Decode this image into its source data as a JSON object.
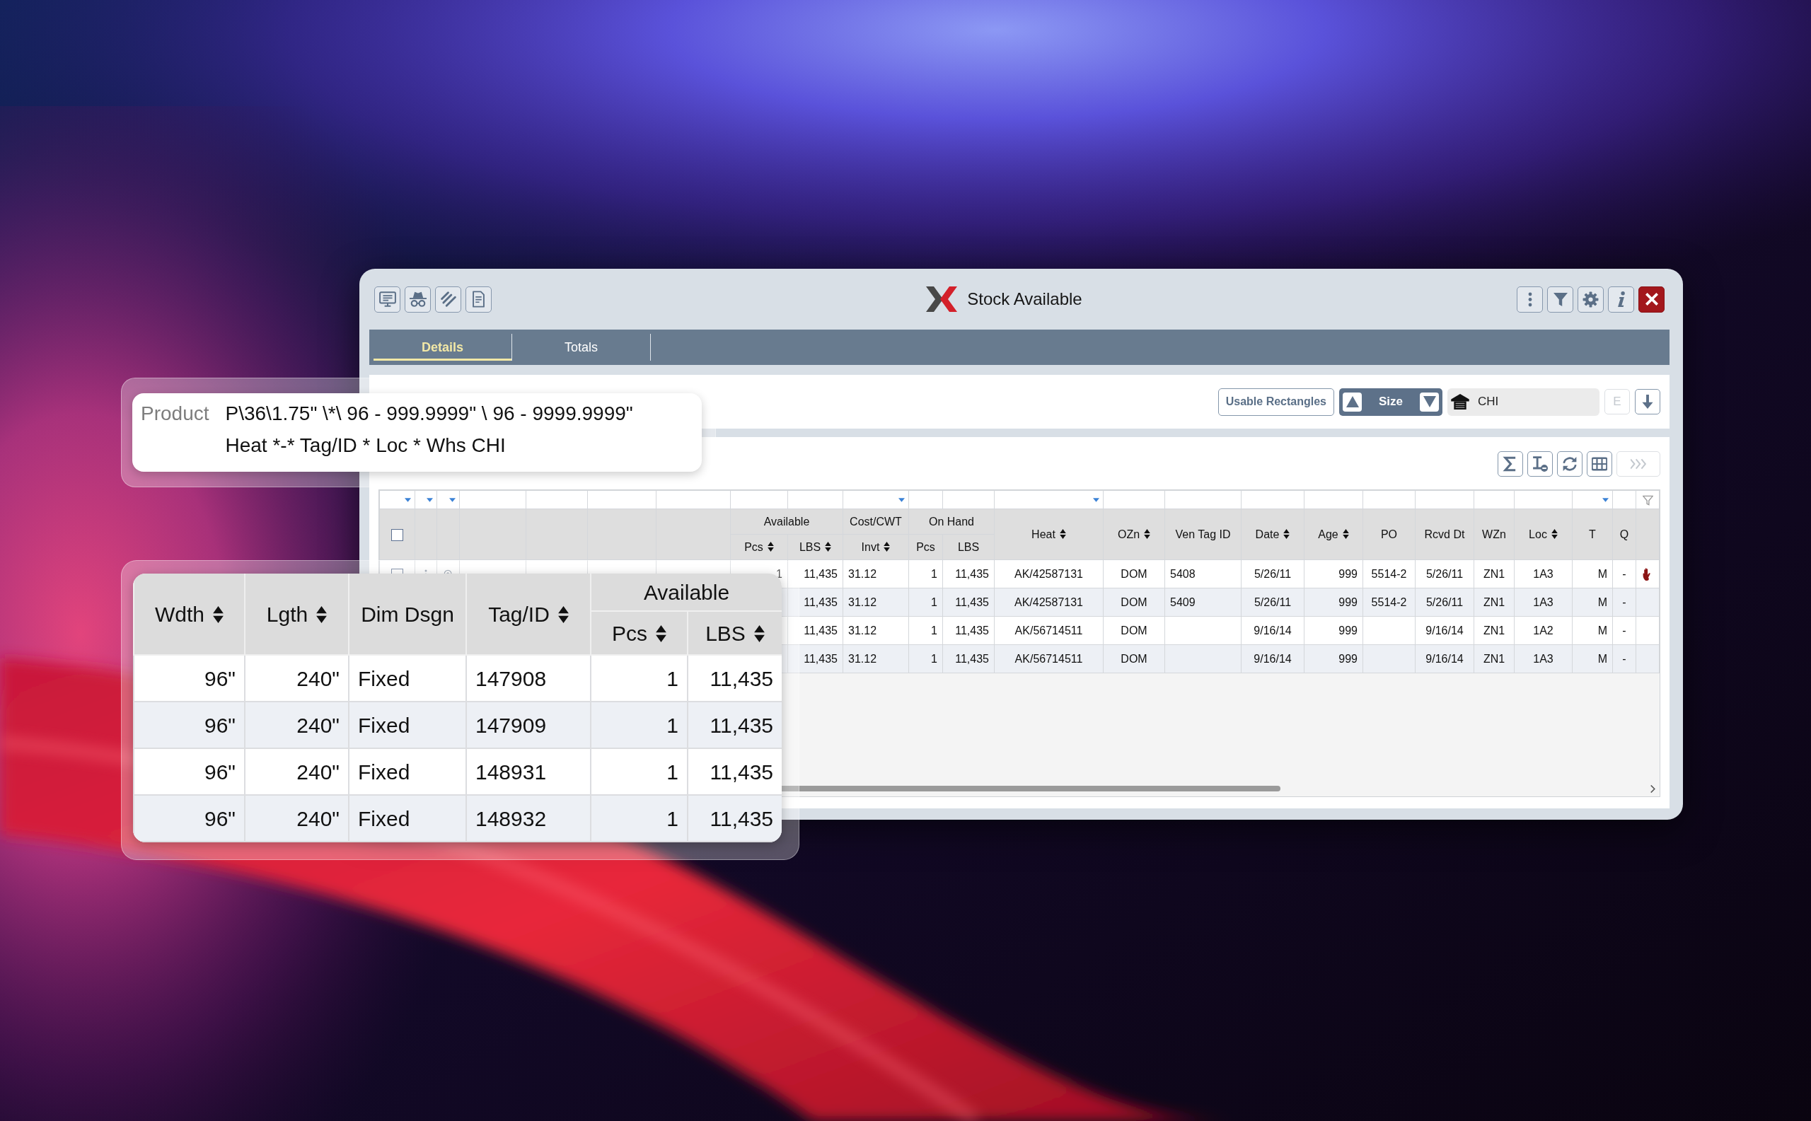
{
  "window": {
    "title": "Stock Available",
    "left_tools": [
      {
        "kind": "screen"
      },
      {
        "kind": "spy"
      },
      {
        "kind": "beams"
      },
      {
        "kind": "invoice"
      }
    ],
    "right_tools": [
      {
        "kind": "more"
      },
      {
        "kind": "filter"
      },
      {
        "kind": "settings"
      },
      {
        "kind": "info"
      },
      {
        "kind": "close"
      }
    ]
  },
  "tabs": [
    {
      "label": "Details",
      "selected": true
    },
    {
      "label": "Totals",
      "selected": false
    }
  ],
  "search_bar": {
    "button": "Usable Rectangles",
    "sort": {
      "label": "Size"
    },
    "warehouse": {
      "value": "CHI"
    },
    "actions": [
      {
        "kind": "letter",
        "label": "E",
        "disabled": true
      },
      {
        "kind": "download",
        "disabled": false
      }
    ]
  },
  "grid_toolbar": [
    {
      "kind": "sum",
      "disabled": false
    },
    {
      "kind": "beam",
      "disabled": false
    },
    {
      "kind": "refresh",
      "disabled": false
    },
    {
      "kind": "columns",
      "disabled": false
    },
    {
      "kind": "expand",
      "disabled": true
    }
  ],
  "grid": {
    "select_all": {
      "checked": false
    },
    "columns": [
      {
        "kind": "select",
        "filter_menu": true
      },
      {
        "kind": "menu",
        "filter_menu": true
      },
      {
        "kind": "zoom",
        "filter_menu": true
      },
      {
        "kind": "blank",
        "filter_menu": false
      },
      {
        "kind": "blank",
        "filter_menu": false
      },
      {
        "kind": "blank",
        "filter_menu": false
      },
      {
        "kind": "blank",
        "filter_menu": false
      },
      {
        "kind": "group",
        "label": "Available",
        "colspan": 2,
        "children": [
          {
            "kind": "number",
            "label": "Pcs",
            "sortable": true,
            "filter_menu": false
          },
          {
            "kind": "number",
            "label": "LBS",
            "sortable": true,
            "filter_menu": false
          }
        ]
      },
      {
        "kind": "group",
        "label": "Cost/CWT",
        "children": [
          {
            "kind": "text",
            "label": "Invt",
            "sortable": true,
            "filter_menu": true
          }
        ]
      },
      {
        "kind": "group",
        "label": "On Hand",
        "colspan": 2,
        "children": [
          {
            "kind": "number",
            "label": "Pcs",
            "sortable": false,
            "filter_menu": false
          },
          {
            "kind": "number",
            "label": "LBS",
            "sortable": false,
            "filter_menu": false
          }
        ]
      },
      {
        "kind": "code",
        "label": "Heat",
        "sortable": true,
        "filter_menu": true
      },
      {
        "kind": "code",
        "label": "OZn",
        "sortable": true,
        "filter_menu": false
      },
      {
        "kind": "text",
        "label": "Ven Tag ID",
        "sortable": false,
        "filter_menu": false
      },
      {
        "kind": "code",
        "label": "Date",
        "sortable": true,
        "filter_menu": false
      },
      {
        "kind": "number",
        "label": "Age",
        "sortable": true,
        "filter_menu": false
      },
      {
        "kind": "code",
        "label": "PO",
        "sortable": false,
        "filter_menu": false
      },
      {
        "kind": "code",
        "label": "Rcvd Dt",
        "sortable": false,
        "filter_menu": false
      },
      {
        "kind": "code",
        "label": "WZn",
        "sortable": false,
        "filter_menu": false
      },
      {
        "kind": "code",
        "label": "Loc",
        "sortable": true,
        "filter_menu": false
      },
      {
        "kind": "number",
        "label": "T",
        "sortable": false,
        "filter_menu": true
      },
      {
        "kind": "code",
        "label": "Q",
        "sortable": false,
        "filter_menu": false
      },
      {
        "kind": "flag",
        "filter_menu": false
      }
    ],
    "rows": [
      {
        "controls": {
          "checked": false
        },
        "on_hold": true,
        "cells": [
          "",
          "",
          "",
          "",
          "",
          "",
          "",
          "1",
          "11,435",
          "31.12",
          "1",
          "11,435",
          "AK/42587131",
          "DOM",
          "5408",
          "5/26/11",
          "999",
          "5514-2",
          "5/26/11",
          "ZN1",
          "1A3",
          "M",
          "-",
          ""
        ]
      },
      {
        "on_hold": false,
        "cells": [
          "",
          "",
          "",
          "",
          "",
          "",
          "",
          "",
          "11,435",
          "31.12",
          "1",
          "11,435",
          "AK/42587131",
          "DOM",
          "5409",
          "5/26/11",
          "999",
          "5514-2",
          "5/26/11",
          "ZN1",
          "1A3",
          "M",
          "-",
          ""
        ]
      },
      {
        "on_hold": false,
        "cells": [
          "",
          "",
          "",
          "",
          "",
          "",
          "",
          "",
          "11,435",
          "31.12",
          "1",
          "11,435",
          "AK/56714511",
          "DOM",
          "",
          "9/16/14",
          "999",
          "",
          "9/16/14",
          "ZN1",
          "1A2",
          "M",
          "-",
          ""
        ]
      },
      {
        "on_hold": false,
        "cells": [
          "",
          "",
          "",
          "",
          "",
          "",
          "",
          "",
          "11,435",
          "31.12",
          "1",
          "11,435",
          "AK/56714511",
          "DOM",
          "",
          "9/16/14",
          "999",
          "",
          "9/16/14",
          "ZN1",
          "1A3",
          "M",
          "-",
          ""
        ]
      }
    ]
  },
  "product_popup": {
    "label": "Product",
    "value": "P\\36\\1.75\" \\*\\ 96 - 999.9999\" \\ 96 - 9999.9999\" Heat *-* Tag/ID * Loc * Whs CHI"
  },
  "zoomed_table": {
    "columns": [
      {
        "kind": "number",
        "label": "Wdth",
        "sortable": true
      },
      {
        "kind": "number",
        "label": "Lgth",
        "sortable": true
      },
      {
        "kind": "text",
        "label": "Dim Dsgn",
        "sortable": false
      },
      {
        "kind": "text",
        "label": "Tag/ID",
        "sortable": true
      },
      {
        "kind": "group",
        "label": "Available",
        "colspan": 2,
        "children": [
          {
            "kind": "number",
            "label": "Pcs",
            "sortable": true
          },
          {
            "kind": "number",
            "label": "LBS",
            "sortable": true
          }
        ]
      }
    ],
    "rows": [
      {
        "cells": [
          "96\"",
          "240\"",
          "Fixed",
          "147908",
          "1",
          "11,435"
        ]
      },
      {
        "cells": [
          "96\"",
          "240\"",
          "Fixed",
          "147909",
          "1",
          "11,435"
        ]
      },
      {
        "cells": [
          "96\"",
          "240\"",
          "Fixed",
          "148931",
          "1",
          "11,435"
        ]
      },
      {
        "cells": [
          "96\"",
          "240\"",
          "Fixed",
          "148932",
          "1",
          "11,435"
        ]
      }
    ]
  }
}
